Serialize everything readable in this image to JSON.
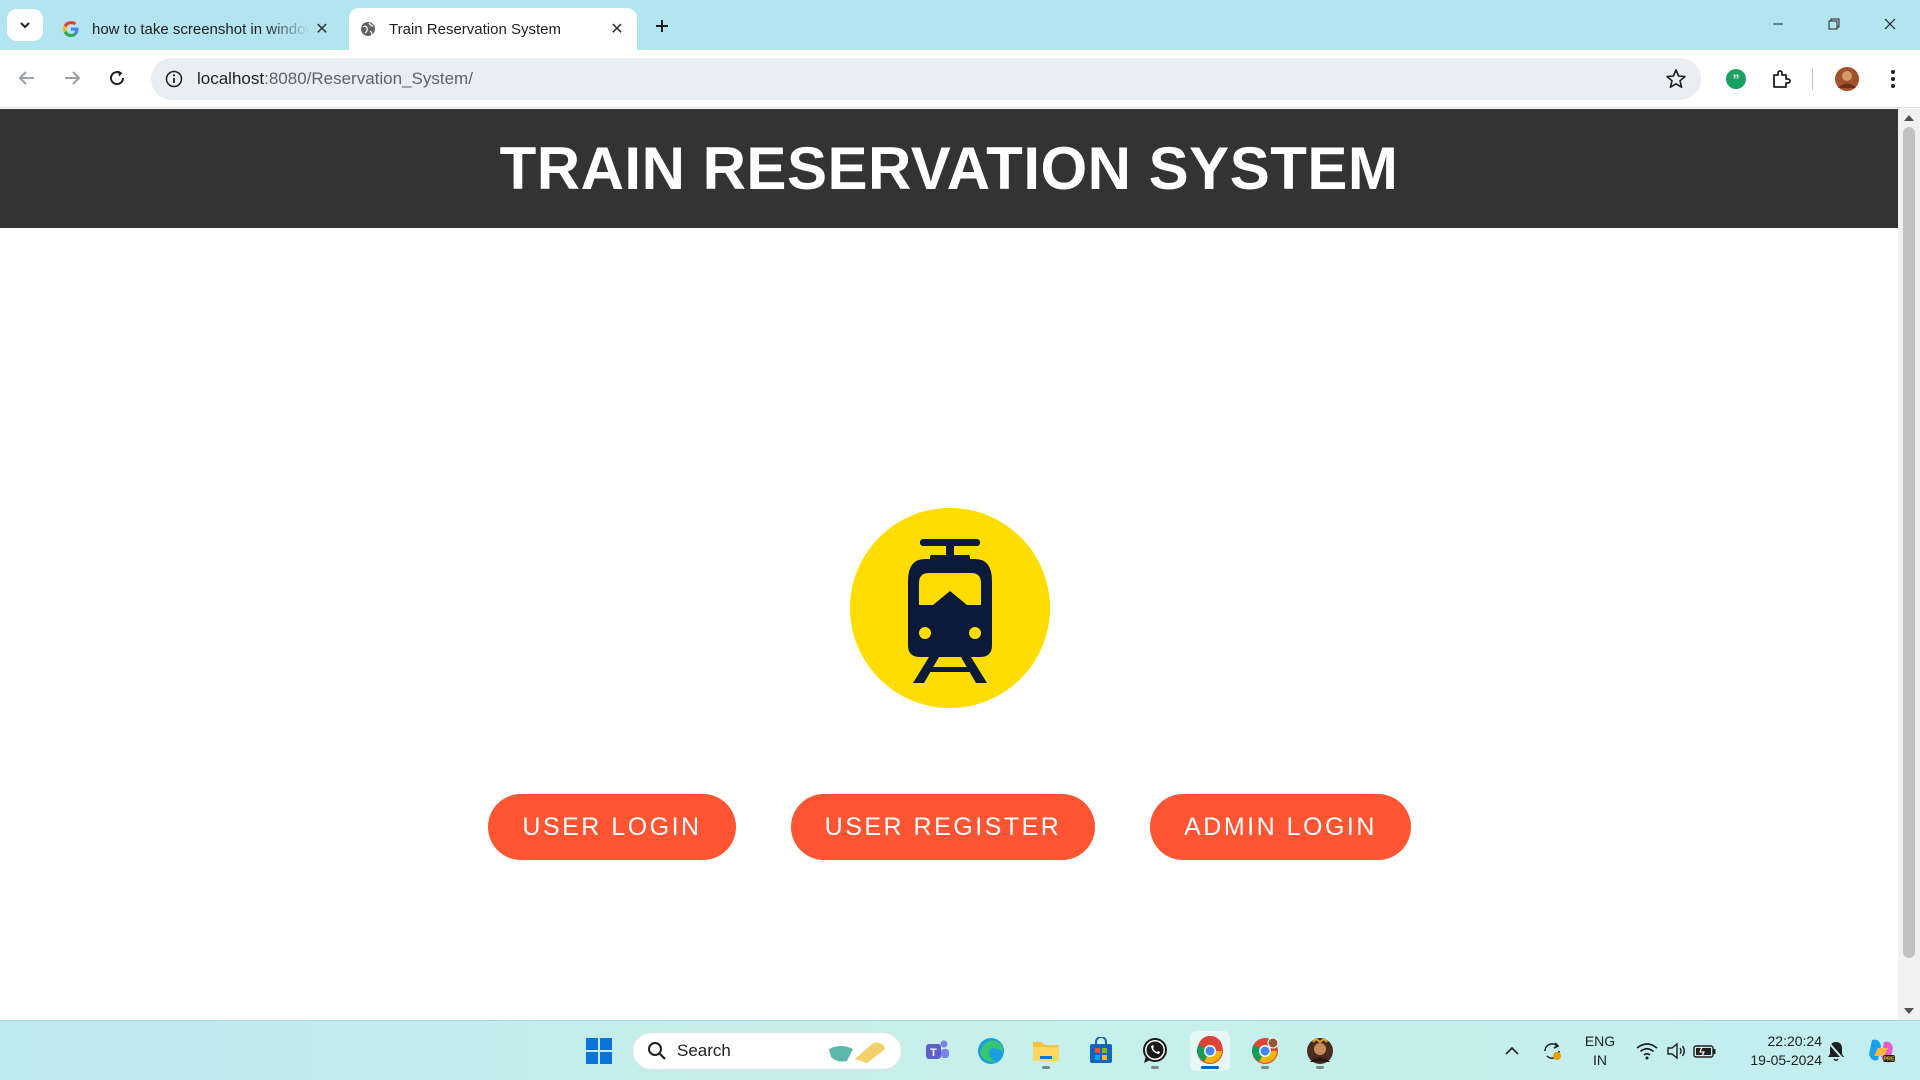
{
  "browser": {
    "tabs": [
      {
        "title": "how to take screenshot in windows",
        "favicon": "google-icon",
        "active": false
      },
      {
        "title": "Train Reservation System",
        "favicon": "globe-icon",
        "active": true
      }
    ],
    "url": {
      "host": "localhost",
      "path": ":8080/Reservation_System/"
    }
  },
  "page": {
    "title": "TRAIN RESERVATION SYSTEM",
    "logo_icon": "train-icon",
    "buttons": {
      "user_login": "USER LOGIN",
      "user_register": "USER REGISTER",
      "admin_login": "ADMIN LOGIN"
    },
    "colors": {
      "header_bg": "#333333",
      "button_bg": "#ff5533",
      "logo_bg": "#ffdd00",
      "logo_fg": "#0b1a3a"
    }
  },
  "taskbar": {
    "search_label": "Search",
    "language": {
      "line1": "ENG",
      "line2": "IN"
    },
    "clock": {
      "time": "22:20:24",
      "date": "19-05-2024"
    }
  }
}
